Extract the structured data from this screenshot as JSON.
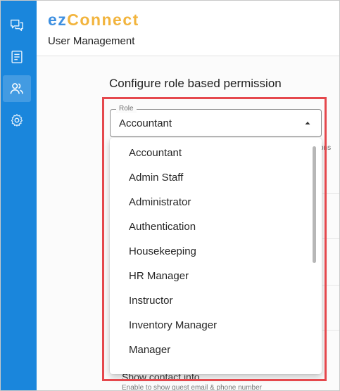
{
  "sidebar": {
    "items": [
      {
        "icon": "chat-icon",
        "active": false
      },
      {
        "icon": "document-icon",
        "active": false
      },
      {
        "icon": "users-icon",
        "active": true
      },
      {
        "icon": "gear-icon",
        "active": false
      }
    ]
  },
  "header": {
    "brand_prefix": "ez",
    "brand_suffix": "Connect",
    "page_title": "User Management",
    "colors": {
      "brand_prefix": "#3d8fe0",
      "brand_suffix": "#f2b43d",
      "sidebar": "#1a86dc"
    }
  },
  "main": {
    "section_title": "Configure role based permission",
    "role_select": {
      "label": "Role",
      "value": "Accountant",
      "options": [
        "Accountant",
        "Admin Staff",
        "Administrator",
        "Authentication",
        "Housekeeping",
        "HR Manager",
        "Instructor",
        "Inventory Manager",
        "Manager"
      ]
    },
    "background": {
      "peek_text": "ons",
      "show_contact_title": "Show contact info",
      "show_contact_desc": "Enable to show guest email & phone number"
    }
  },
  "annotation": {
    "color": "#e5484d"
  }
}
